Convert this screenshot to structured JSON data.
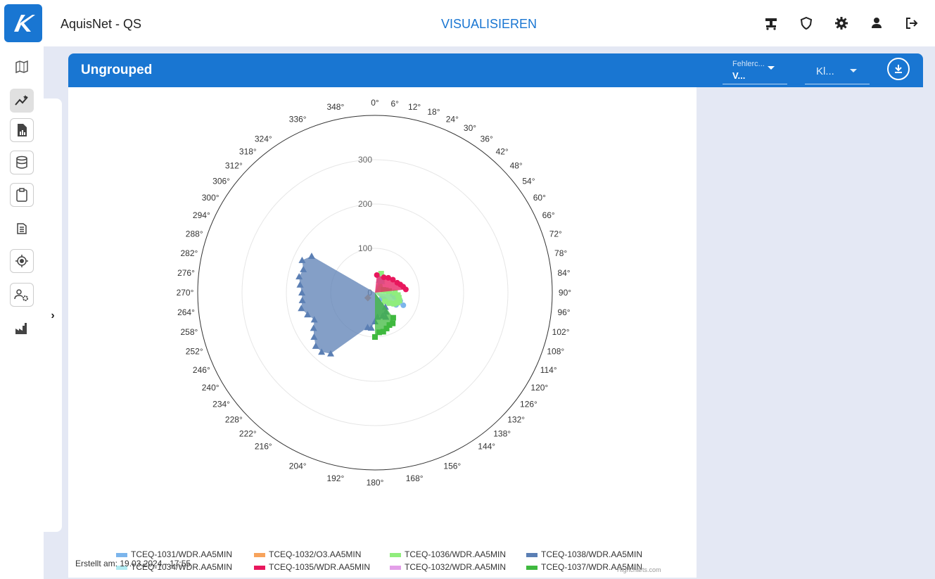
{
  "app": {
    "title": "AquisNet - QS",
    "mode": "VISUALISIEREN"
  },
  "topbar_icons": [
    "mobile-station-icon",
    "shield-icon",
    "gear-icon",
    "user-icon",
    "logout-icon"
  ],
  "sidebar": {
    "items": [
      {
        "icon": "map-icon"
      },
      {
        "icon": "visualize-icon",
        "active": true
      },
      {
        "icon": "report-icon"
      },
      {
        "icon": "database-icon"
      },
      {
        "icon": "clipboard-icon"
      },
      {
        "icon": "layers-list-icon"
      },
      {
        "icon": "target-icon"
      },
      {
        "icon": "user-settings-icon"
      },
      {
        "icon": "factory-icon"
      }
    ]
  },
  "card": {
    "title": "Ungrouped",
    "dropdown1": {
      "label": "Fehlerc...",
      "value": "V..."
    },
    "dropdown2": {
      "value": "Kl..."
    },
    "created": "Erstellt am: 19.03.2024 - 17:55",
    "credits": "Highcharts.com"
  },
  "colors": {
    "brand": "#1976d2"
  },
  "chart_data": {
    "type": "polar",
    "x_tick_labels": [
      "0°",
      "6°",
      "12°",
      "18°",
      "24°",
      "30°",
      "36°",
      "42°",
      "48°",
      "54°",
      "60°",
      "66°",
      "72°",
      "78°",
      "84°",
      "90°",
      "96°",
      "102°",
      "108°",
      "114°",
      "120°",
      "126°",
      "132°",
      "138°",
      "144°",
      "156°",
      "168°",
      "180°",
      "192°",
      "204°",
      "216°",
      "222°",
      "228°",
      "234°",
      "240°",
      "246°",
      "252°",
      "258°",
      "264°",
      "270°",
      "276°",
      "282°",
      "288°",
      "294°",
      "300°",
      "306°",
      "312°",
      "318°",
      "324°",
      "336°",
      "348°"
    ],
    "y_tick_labels": [
      "0",
      "100",
      "200",
      "300"
    ],
    "ylim": [
      0,
      400
    ],
    "series": [
      {
        "name": "TCEQ-1031/WDR.AA5MIN",
        "color": "#7cb5ec",
        "data": [
          [
            96,
            40
          ],
          [
            102,
            45
          ],
          [
            108,
            60
          ],
          [
            114,
            70
          ],
          [
            120,
            55
          ],
          [
            126,
            25
          ],
          [
            132,
            20
          ]
        ]
      },
      {
        "name": "TCEQ-1032/O3.AA5MIN",
        "color": "#f7a35c",
        "data": [
          [
            234,
            20
          ]
        ]
      },
      {
        "name": "TCEQ-1036/WDR.AA5MIN",
        "color": "#90ed7d",
        "data": [
          [
            18,
            45
          ],
          [
            30,
            30
          ],
          [
            72,
            20
          ],
          [
            78,
            25
          ],
          [
            84,
            32
          ],
          [
            90,
            45
          ],
          [
            96,
            52
          ],
          [
            102,
            55
          ],
          [
            108,
            58
          ],
          [
            114,
            55
          ],
          [
            120,
            50
          ],
          [
            126,
            40
          ],
          [
            132,
            30
          ]
        ]
      },
      {
        "name": "TCEQ-1038/WDR.AA5MIN",
        "color": "#5b7fb4",
        "data": [
          [
            144,
            40
          ],
          [
            150,
            50
          ],
          [
            156,
            60
          ],
          [
            162,
            55
          ],
          [
            174,
            55
          ],
          [
            180,
            65
          ],
          [
            186,
            80
          ],
          [
            192,
            80
          ],
          [
            216,
            170
          ],
          [
            222,
            180
          ],
          [
            228,
            180
          ],
          [
            234,
            170
          ],
          [
            240,
            160
          ],
          [
            246,
            150
          ],
          [
            252,
            160
          ],
          [
            258,
            170
          ],
          [
            264,
            165
          ],
          [
            270,
            165
          ],
          [
            276,
            170
          ],
          [
            282,
            175
          ],
          [
            288,
            170
          ],
          [
            294,
            180
          ],
          [
            300,
            165
          ]
        ]
      },
      {
        "name": "TCEQ-1034/WDR.AA5MIN",
        "color": "#b2ebf2",
        "data": [
          [
            18,
            30
          ],
          [
            24,
            35
          ],
          [
            30,
            30
          ]
        ]
      },
      {
        "name": "TCEQ-1035/WDR.AA5MIN",
        "color": "#e8175d",
        "data": [
          [
            6,
            40
          ],
          [
            30,
            40
          ],
          [
            42,
            45
          ],
          [
            54,
            50
          ],
          [
            66,
            55
          ],
          [
            72,
            60
          ],
          [
            78,
            65
          ],
          [
            84,
            70
          ]
        ]
      },
      {
        "name": "TCEQ-1032/WDR.AA5MIN",
        "color": "#e39fe8",
        "data": []
      },
      {
        "name": "TCEQ-1037/WDR.AA5MIN",
        "color": "#3fb93f",
        "data": [
          [
            144,
            70
          ],
          [
            150,
            80
          ],
          [
            156,
            80
          ],
          [
            162,
            85
          ],
          [
            168,
            90
          ],
          [
            174,
            90
          ],
          [
            180,
            100
          ]
        ]
      }
    ],
    "legend_placement": "bottom"
  }
}
